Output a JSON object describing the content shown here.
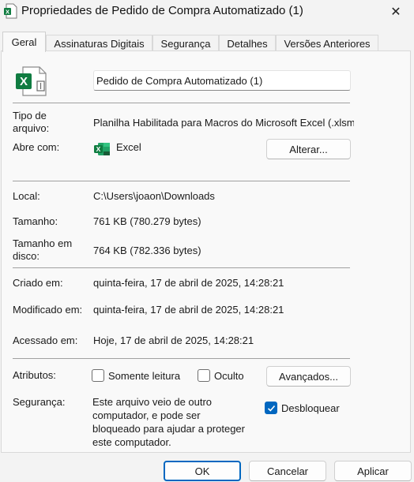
{
  "window": {
    "title": "Propriedades de Pedido de Compra Automatizado (1)",
    "close_glyph": "✕"
  },
  "tabs": [
    {
      "label": "Geral",
      "active": true
    },
    {
      "label": "Assinaturas Digitais"
    },
    {
      "label": "Segurança"
    },
    {
      "label": "Detalhes"
    },
    {
      "label": "Versões Anteriores"
    }
  ],
  "file": {
    "icon": "excel-file-icon",
    "name": "Pedido de Compra Automatizado (1)"
  },
  "type_row": {
    "label": "Tipo de arquivo:",
    "value": "Planilha Habilitada para Macros do Microsoft Excel (.xlsm)"
  },
  "opens_with": {
    "label": "Abre com:",
    "app": "Excel",
    "app_icon": "excel-icon",
    "change_button": "Alterar..."
  },
  "location": {
    "label": "Local:",
    "value": "C:\\Users\\joaon\\Downloads"
  },
  "size": {
    "label": "Tamanho:",
    "value": "761 KB (780.279 bytes)"
  },
  "size_on_disk": {
    "label": "Tamanho em disco:",
    "value": "764 KB (782.336 bytes)"
  },
  "created": {
    "label": "Criado em:",
    "value": "quinta-feira, 17 de abril de 2025, 14:28:21"
  },
  "modified": {
    "label": "Modificado em:",
    "value": "quinta-feira, 17 de abril de 2025, 14:28:21"
  },
  "accessed": {
    "label": "Acessado em:",
    "value": "Hoje, 17 de abril de 2025, 14:28:21"
  },
  "attributes": {
    "label": "Atributos:",
    "read_only": {
      "label": "Somente leitura",
      "checked": false
    },
    "hidden": {
      "label": "Oculto",
      "checked": false
    },
    "advanced_button": "Avançados..."
  },
  "security": {
    "label": "Segurança:",
    "text": "Este arquivo veio de outro\ncomputador, e pode ser\nbloqueado para ajudar a proteger\neste computador.",
    "unblock": {
      "label": "Desbloquear",
      "checked": true
    }
  },
  "footer": {
    "ok": "OK",
    "cancel": "Cancelar",
    "apply": "Aplicar"
  },
  "colors": {
    "accent": "#0067c0",
    "excel_green": "#107c41"
  }
}
